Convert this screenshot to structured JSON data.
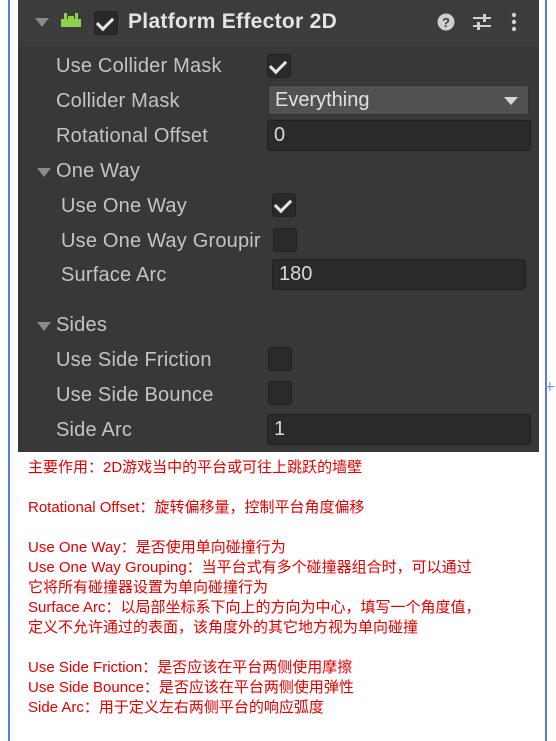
{
  "component": {
    "title": "Platform Effector 2D",
    "enabled": true,
    "icons": [
      "platform-effector-icon",
      "help-icon",
      "presets-icon",
      "more-options-icon"
    ]
  },
  "fields": {
    "use_collider_mask": {
      "label": "Use Collider Mask",
      "checked": true
    },
    "collider_mask": {
      "label": "Collider Mask",
      "value": "Everything"
    },
    "rotational_offset": {
      "label": "Rotational Offset",
      "value": "0"
    },
    "one_way_section": {
      "label": "One Way",
      "expanded": true
    },
    "use_one_way": {
      "label": "Use One Way",
      "checked": true
    },
    "use_one_way_grouping": {
      "label": "Use One Way Groupir",
      "checked": false
    },
    "surface_arc": {
      "label": "Surface Arc",
      "value": "180"
    },
    "sides_section": {
      "label": "Sides",
      "expanded": true
    },
    "use_side_friction": {
      "label": "Use Side Friction",
      "checked": false
    },
    "use_side_bounce": {
      "label": "Use Side Bounce",
      "checked": false
    },
    "side_arc": {
      "label": "Side Arc",
      "value": "1"
    }
  },
  "notes": {
    "line1": "主要作用：2D游戏当中的平台或可往上跳跃的墙壁",
    "line2": "Rotational Offset：旋转偏移量，控制平台角度偏移",
    "line3": "Use One Way：是否使用单向碰撞行为",
    "line4": "Use One Way Grouping：当平台式有多个碰撞器组合时，可以通过",
    "line5": "它将所有碰撞器设置为单向碰撞行为",
    "line6": "Surface Arc：以局部坐标系下向上的方向为中心，填写一个角度值，",
    "line7": "定义不允许通过的表面，该角度外的其它地方视为单向碰撞",
    "line8": "Use Side Friction：是否应该在平台两侧使用摩擦",
    "line9": "Use Side Bounce：是否应该在平台两侧使用弹性",
    "line10": "Side Arc：用于定义左右两侧平台的响应弧度"
  },
  "colors": {
    "panel_bg": "#383838",
    "field_bg": "#2a2a2a",
    "note_text": "#e00000",
    "frame_border": "#4f7fd6",
    "component_icon": "#8fd14f"
  }
}
